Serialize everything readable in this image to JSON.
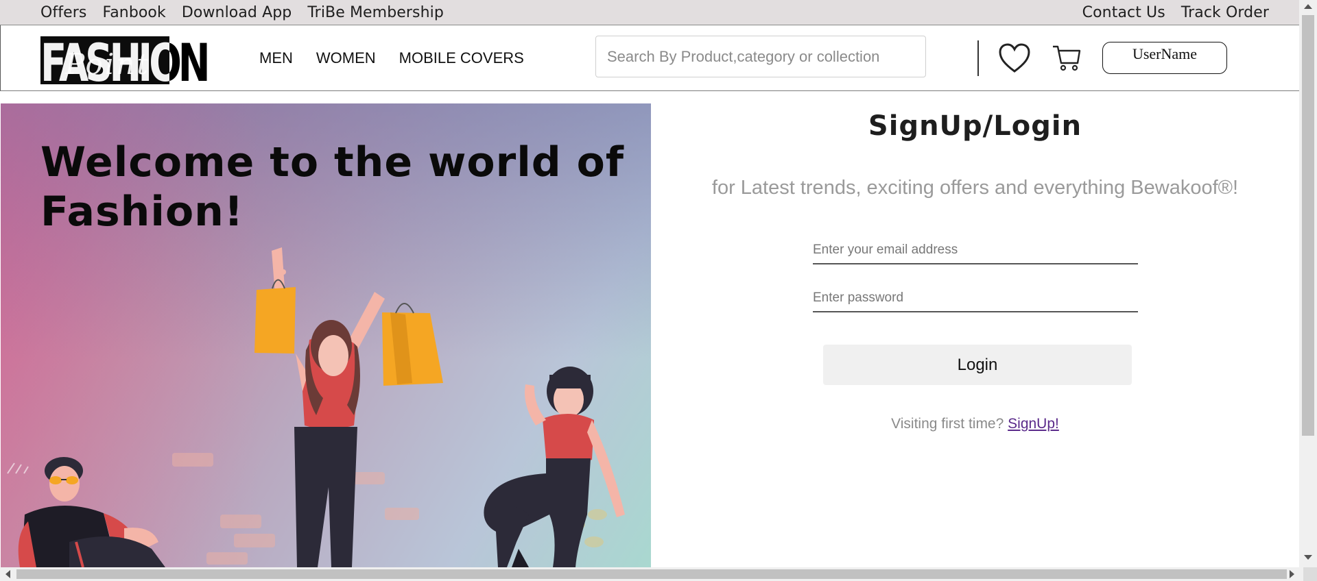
{
  "topbar": {
    "left_links": [
      "Offers",
      "Fanbook",
      "Download App",
      "TriBe Membership"
    ],
    "right_links": [
      "Contact Us",
      "Track Order"
    ]
  },
  "nav": {
    "logo_word": "FASHION",
    "logo_script": "Point",
    "links": [
      "MEN",
      "WOMEN",
      "MOBILE COVERS"
    ],
    "search_placeholder": "Search By Product,category or collection",
    "icons": [
      "heart-icon",
      "cart-icon"
    ],
    "user_button": "UserName"
  },
  "hero": {
    "headline": "Welcome to the world of Fashion!",
    "colors": {
      "left": "#c85d90",
      "right": "#a9d8d0"
    }
  },
  "login": {
    "title": "SignUp/Login",
    "tagline": "for Latest trends, exciting offers and everything Bewakoof®!",
    "email_placeholder": "Enter your email address",
    "password_placeholder": "Enter password",
    "login_button": "Login",
    "first_time_text": "Visiting first time?",
    "signup_link": "SignUp!"
  }
}
